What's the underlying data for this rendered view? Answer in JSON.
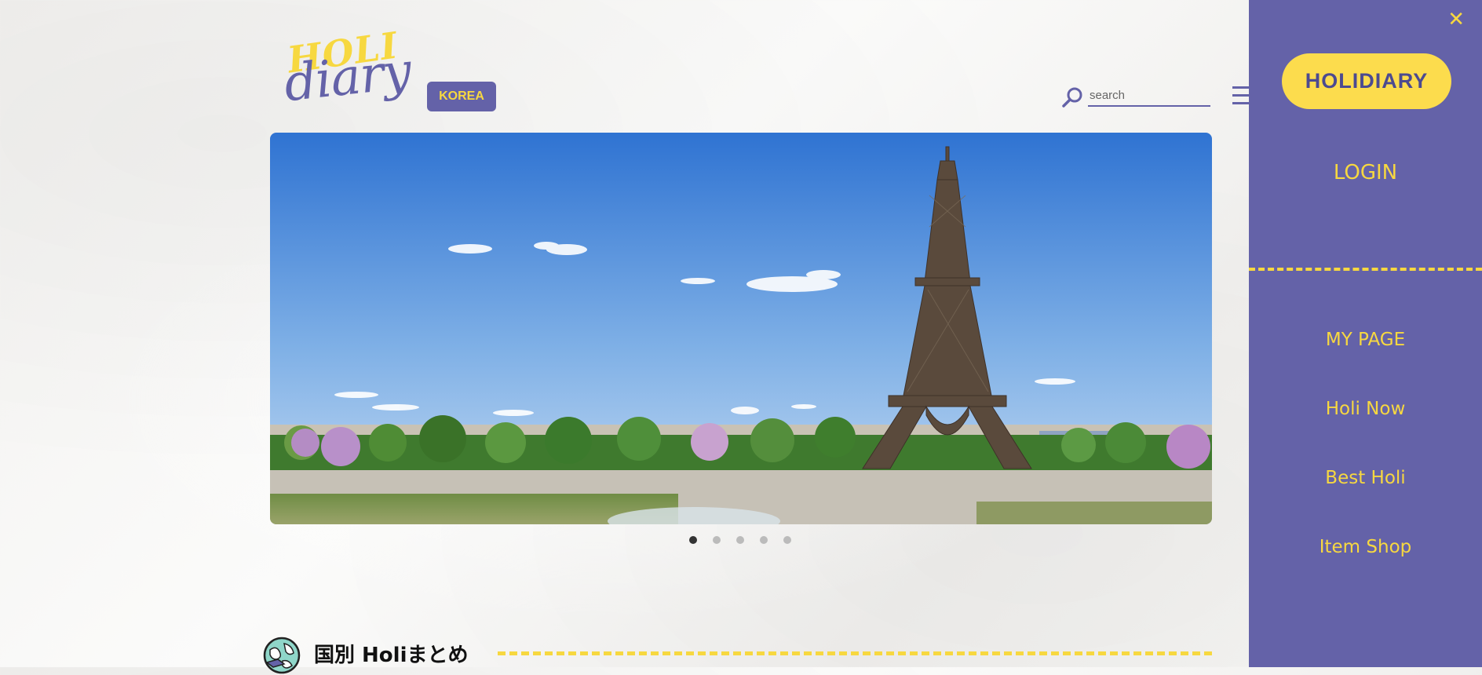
{
  "header": {
    "logo_top": "HOLI",
    "logo_bottom": "diary",
    "country_badge": "KOREA",
    "search_placeholder": "search"
  },
  "banner": {
    "carousel_total": 5,
    "carousel_active": 1
  },
  "section": {
    "title": "国別 Holiまとめ"
  },
  "drawer": {
    "close_label": "✕",
    "brand_label": "HOLIDIARY",
    "login_label": "LOGIN",
    "items": [
      {
        "label": "MY PAGE"
      },
      {
        "label": "Holi Now"
      },
      {
        "label": "Best Holi"
      },
      {
        "label": "Item Shop"
      }
    ]
  },
  "colors": {
    "primary": "#6462a8",
    "accent": "#f7d840"
  },
  "icons": [
    "search-icon",
    "menu-icon",
    "close-icon",
    "globe-icon"
  ]
}
